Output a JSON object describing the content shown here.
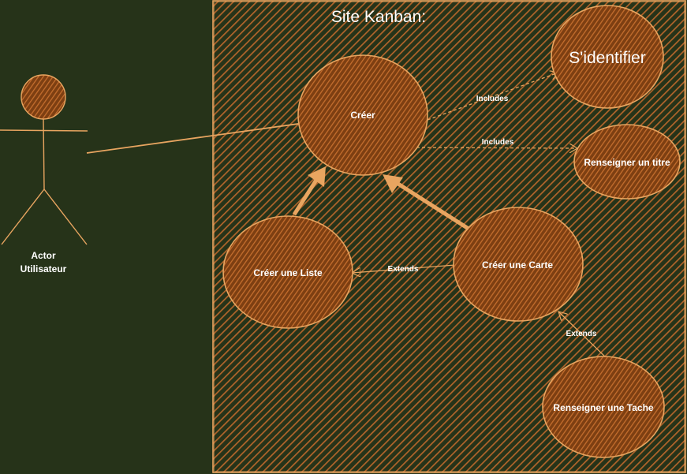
{
  "system": {
    "title": "Site Kanban:"
  },
  "actor": {
    "line1": "Actor",
    "line2": "Utilisateur"
  },
  "use_cases": {
    "creer": "Créer",
    "identifier": "S'identifier",
    "titre": "Renseigner un titre",
    "liste": "Créer une Liste",
    "carte": "Créer une Carte",
    "tache": "Renseigner une Tache"
  },
  "relations": {
    "includes_1": "Includes",
    "includes_2": "Includes",
    "extends_1": "Extends",
    "extends_2": "Extends"
  },
  "colors": {
    "background": "#263319",
    "accent": "#e8a560",
    "fill": "#a85a1f",
    "text": "#ffffff"
  }
}
